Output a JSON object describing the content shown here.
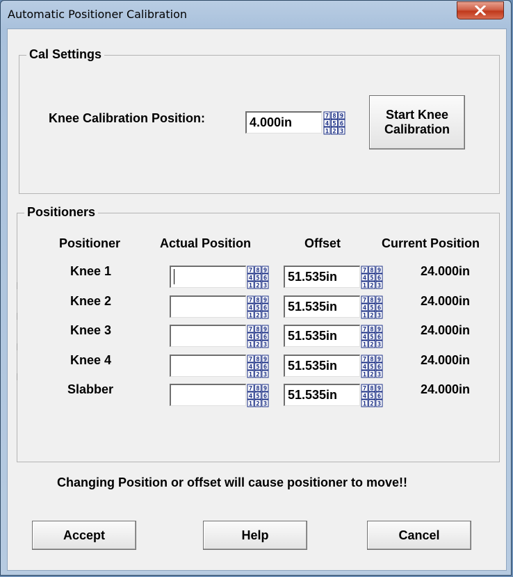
{
  "window": {
    "title": "Automatic Positioner Calibration"
  },
  "cal_settings": {
    "title": "Cal Settings",
    "knee_label": "Knee Calibration Position:",
    "knee_value": "4.000in",
    "start_button": "Start Knee Calibration"
  },
  "positioners": {
    "title": "Positioners",
    "headers": [
      "Positioner",
      "Actual Position",
      "Offset",
      "Current Position"
    ],
    "rows": [
      {
        "name": "Knee 1",
        "actual": "",
        "offset": "51.535in",
        "current": "24.000in"
      },
      {
        "name": "Knee 2",
        "actual": "",
        "offset": "51.535in",
        "current": "24.000in"
      },
      {
        "name": "Knee 3",
        "actual": "",
        "offset": "51.535in",
        "current": "24.000in"
      },
      {
        "name": "Knee 4",
        "actual": "",
        "offset": "51.535in",
        "current": "24.000in"
      },
      {
        "name": "Slabber",
        "actual": "",
        "offset": "51.535in",
        "current": "24.000in"
      }
    ]
  },
  "warning": "Changing Position or offset will cause positioner to move!!",
  "buttons": {
    "accept": "Accept",
    "help": "Help",
    "cancel": "Cancel"
  },
  "icons": {
    "keypad": "numeric-keypad-icon",
    "close": "close-icon"
  },
  "keypad_digits": [
    [
      "7",
      "8",
      "9"
    ],
    [
      "4",
      "5",
      "6"
    ],
    [
      "1",
      "2",
      "3"
    ]
  ]
}
